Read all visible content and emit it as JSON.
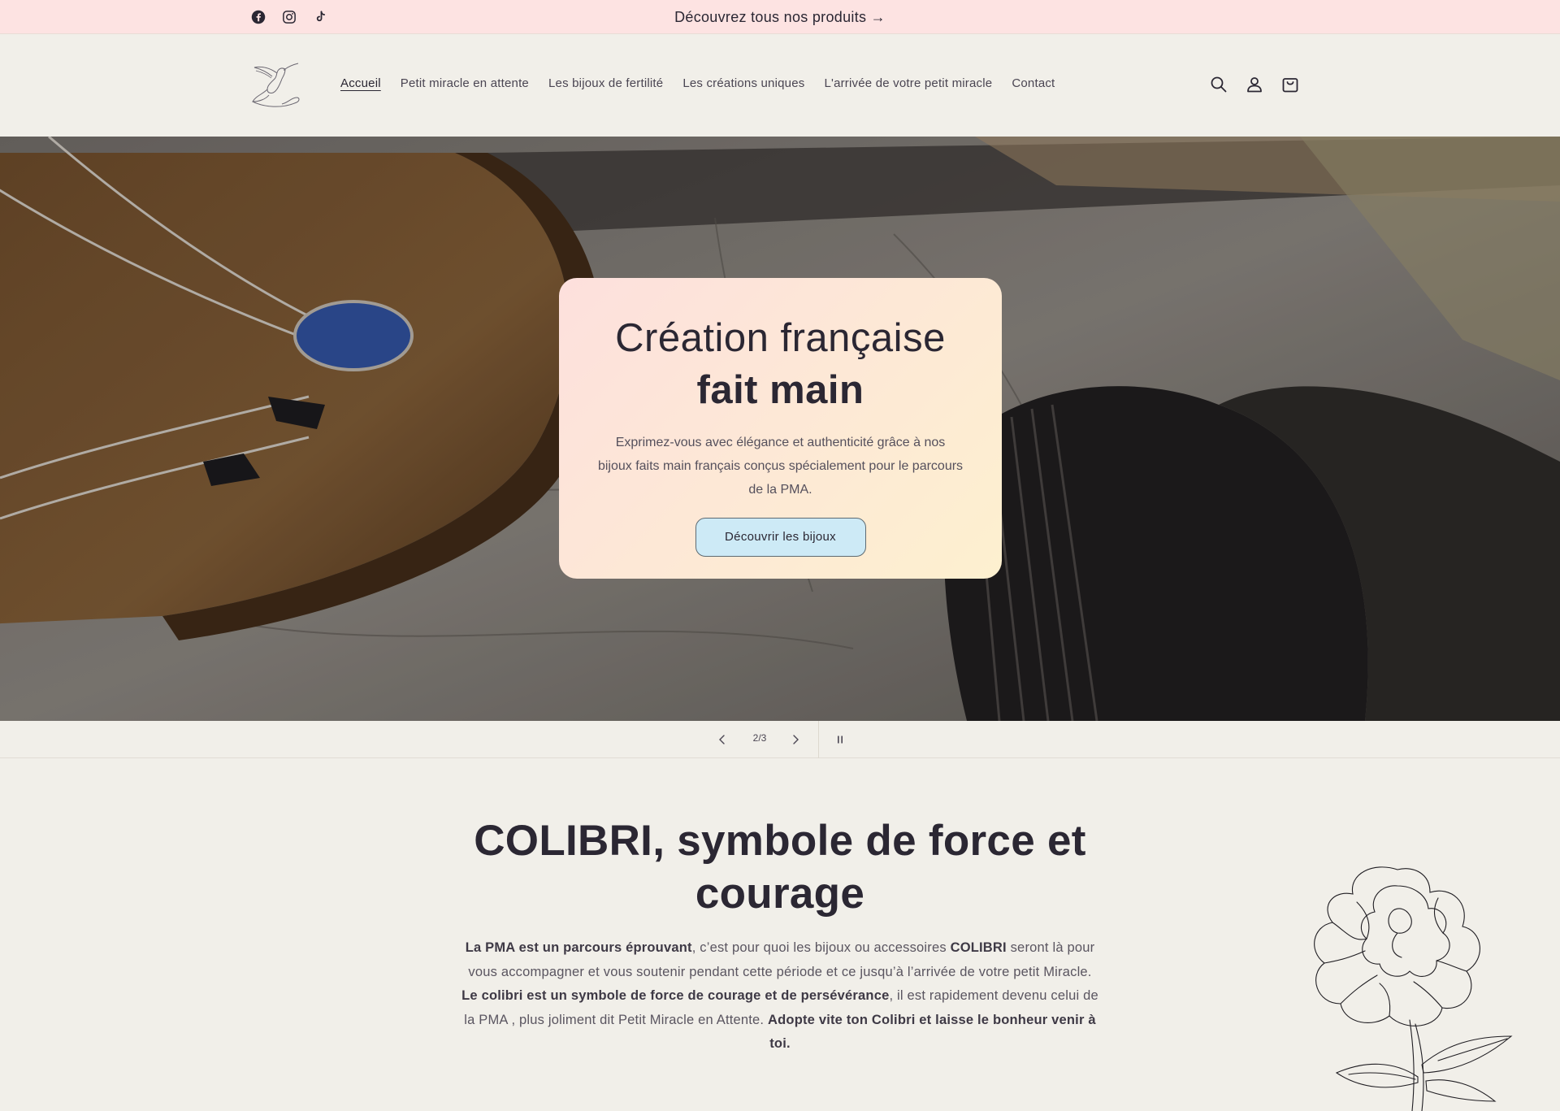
{
  "announcement": {
    "text": "Découvrez tous nos produits →",
    "social": [
      "facebook-icon",
      "instagram-icon",
      "tiktok-icon"
    ]
  },
  "header": {
    "nav": [
      {
        "label": "Accueil",
        "active": true
      },
      {
        "label": "Petit miracle en attente",
        "active": false
      },
      {
        "label": "Les bijoux de fertilité",
        "active": false
      },
      {
        "label": "Les créations uniques",
        "active": false
      },
      {
        "label": "L'arrivée de votre petit miracle",
        "active": false
      },
      {
        "label": "Contact",
        "active": false
      }
    ],
    "icons": [
      "search-icon",
      "account-icon",
      "cart-icon"
    ]
  },
  "hero": {
    "title_line1": "Création française",
    "title_line2": "fait main",
    "text": "Exprimez-vous avec élégance et authenticité grâce à nos bijoux faits main français conçus spécialement pour le parcours de la PMA.",
    "button": "Découvrir les bijoux"
  },
  "slider": {
    "counter": "2/3"
  },
  "intro": {
    "title": "COLIBRI, symbole de force et courage",
    "p1_bold": "La PMA est un parcours éprouvant",
    "p1": ", c’est pour quoi les bijoux ou accessoires ",
    "p2_bold": "COLIBRI",
    "p2": " seront là pour vous accompagner et vous soutenir pendant cette période et ce jusqu’à l’arrivée de votre petit Miracle. ",
    "p3_bold": "Le colibri est un symbole de force de courage et de persévérance",
    "p3": ", il est rapidement devenu celui de la PMA , plus joliment dit Petit Miracle en Attente. ",
    "p4_bold": "Adopte vite ton Colibri et laisse le bonheur venir à toi."
  },
  "colors": {
    "announcement_bg": "#fde3e2",
    "page_bg": "#f1efe9",
    "button_bg": "#cdeaf6",
    "text": "#2b2733"
  }
}
